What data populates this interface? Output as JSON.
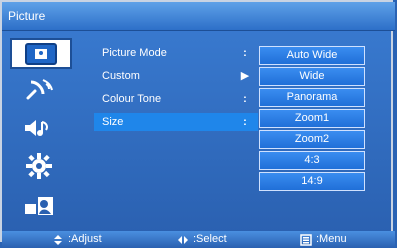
{
  "window": {
    "title": "Picture"
  },
  "rail": {
    "items": [
      {
        "name": "picture-icon",
        "active": true
      },
      {
        "name": "satellite-dish-icon",
        "active": false
      },
      {
        "name": "sound-icon",
        "active": false
      },
      {
        "name": "settings-gear-icon",
        "active": false
      },
      {
        "name": "person-icon",
        "active": false
      }
    ]
  },
  "menu": {
    "rows": [
      {
        "label": "Picture Mode",
        "sep": ":"
      },
      {
        "label": "Custom",
        "sep": "▶"
      },
      {
        "label": "Colour Tone",
        "sep": ":"
      },
      {
        "label": "Size",
        "sep": ":"
      }
    ]
  },
  "dropdown": {
    "options": [
      "Auto Wide",
      "Wide",
      "Panorama",
      "Zoom1",
      "Zoom2",
      "4:3",
      "14:9"
    ]
  },
  "footer": {
    "adjust": ":Adjust",
    "select": ":Select",
    "menu": ":Menu"
  },
  "colors": {
    "background": "#2a63b4",
    "highlight": "#1f86ea",
    "option_border": "#cfe1ff"
  }
}
